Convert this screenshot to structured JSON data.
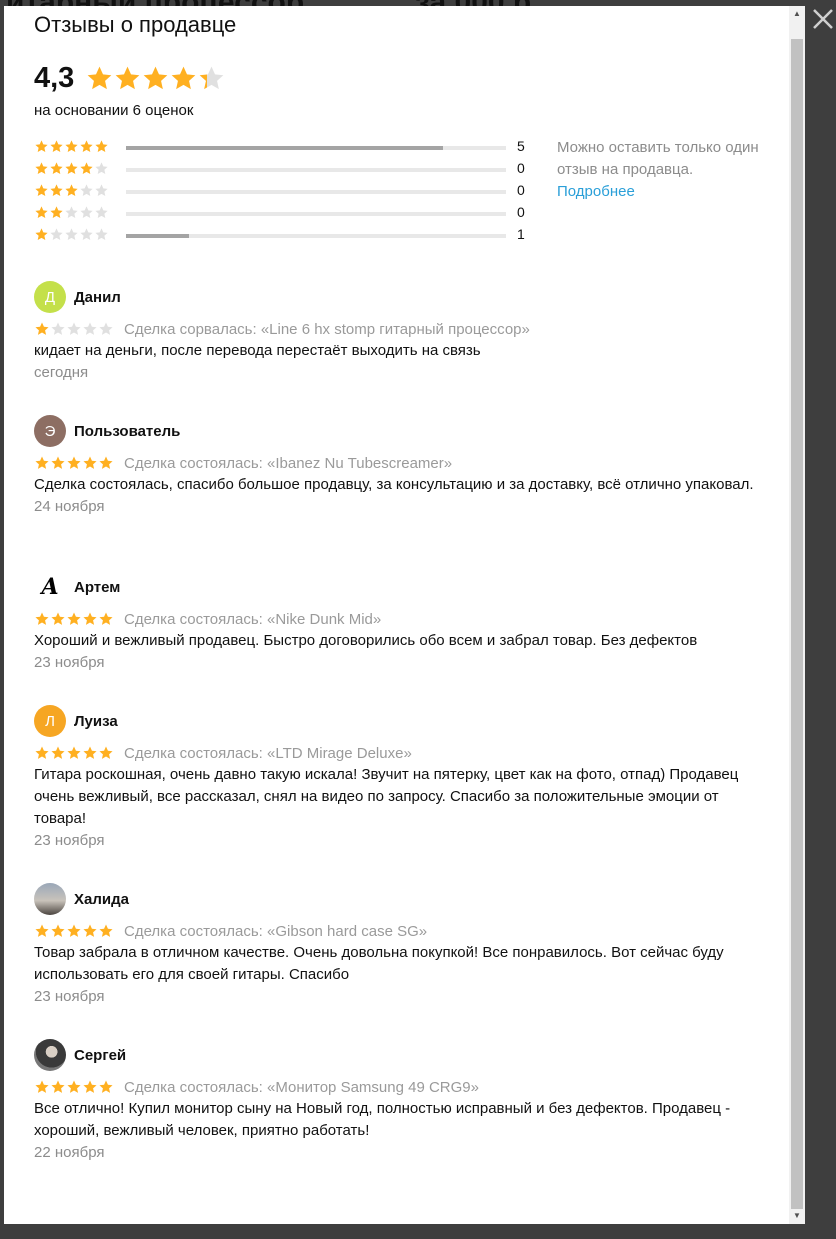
{
  "modal": {
    "title": "Отзывы о продавце",
    "rating": "4,3",
    "rating_value": 4.3,
    "basis": "на основании 6 оценок",
    "distribution": [
      {
        "stars": 5,
        "count": "5",
        "fraction": 0.833
      },
      {
        "stars": 4,
        "count": "0",
        "fraction": 0
      },
      {
        "stars": 3,
        "count": "0",
        "fraction": 0
      },
      {
        "stars": 2,
        "count": "0",
        "fraction": 0
      },
      {
        "stars": 1,
        "count": "1",
        "fraction": 0.167
      }
    ],
    "note_text": "Можно оставить только один отзыв на продавца.",
    "note_link": "Подробнее"
  },
  "reviews": [
    {
      "name": "Данил",
      "avatar_letter": "Д",
      "avatar_color": "#c4e04a",
      "stars": 1,
      "deal": "Сделка сорвалась: «Line 6 hx stomp гитарный процессор»",
      "text": "кидает на деньги, после перевода перестаёт выходить на связь",
      "date": "сегодня"
    },
    {
      "name": "Пользователь",
      "avatar_letter": "Э",
      "avatar_color": "#8d6e63",
      "stars": 5,
      "deal": "Сделка состоялась: «Ibanez Nu Tubescreamer»",
      "text": "Сделка состоялась, спасибо большое продавцу, за консультацию и за доставку, всё отлично упаковал.",
      "date": "24 ноября"
    },
    {
      "name": "Артем",
      "avatar_letter": "A",
      "avatar_color": "#ffffff",
      "stars": 5,
      "deal": "Сделка состоялась: «Nike Dunk Mid»",
      "text": "Хороший и вежливый продавец. Быстро договорились обо всем и забрал товар. Без дефектов",
      "date": "23 ноября"
    },
    {
      "name": "Луиза",
      "avatar_letter": "Л",
      "avatar_color": "#f6a623",
      "stars": 5,
      "deal": "Сделка состоялась: «LTD Mirage Deluxe»",
      "text": "Гитара роскошная, очень давно такую искала! Звучит на пятерку, цвет как на фото, отпад) Продавец очень вежливый, все рассказал, снял на видео по запросу. Спасибо за положительные эмоции от товара!",
      "date": "23 ноября"
    },
    {
      "name": "Халида",
      "avatar_letter": "",
      "avatar_color": "#7f8fa6",
      "stars": 5,
      "deal": "Сделка состоялась: «Gibson hard case SG»",
      "text": "Товар забрала в отличном качестве. Очень довольна покупкой! Все понравилось. Вот сейчас буду использовать его для своей гитары. Спасибо",
      "date": "23 ноября"
    },
    {
      "name": "Сергей",
      "avatar_letter": "",
      "avatar_color": "#5a5a5a",
      "stars": 5,
      "deal": "Сделка состоялась: «Монитор Samsung 49 CRG9»",
      "text": "Все отлично! Купил монитор сыну на Новый год, полностью исправный и без дефектов. Продавец - хороший, вежливый человек, приятно работать!",
      "date": "22 ноября"
    }
  ],
  "colors": {
    "star_on": "#ffb021",
    "star_off": "#e0e0e0",
    "link": "#2a9fd8"
  }
}
